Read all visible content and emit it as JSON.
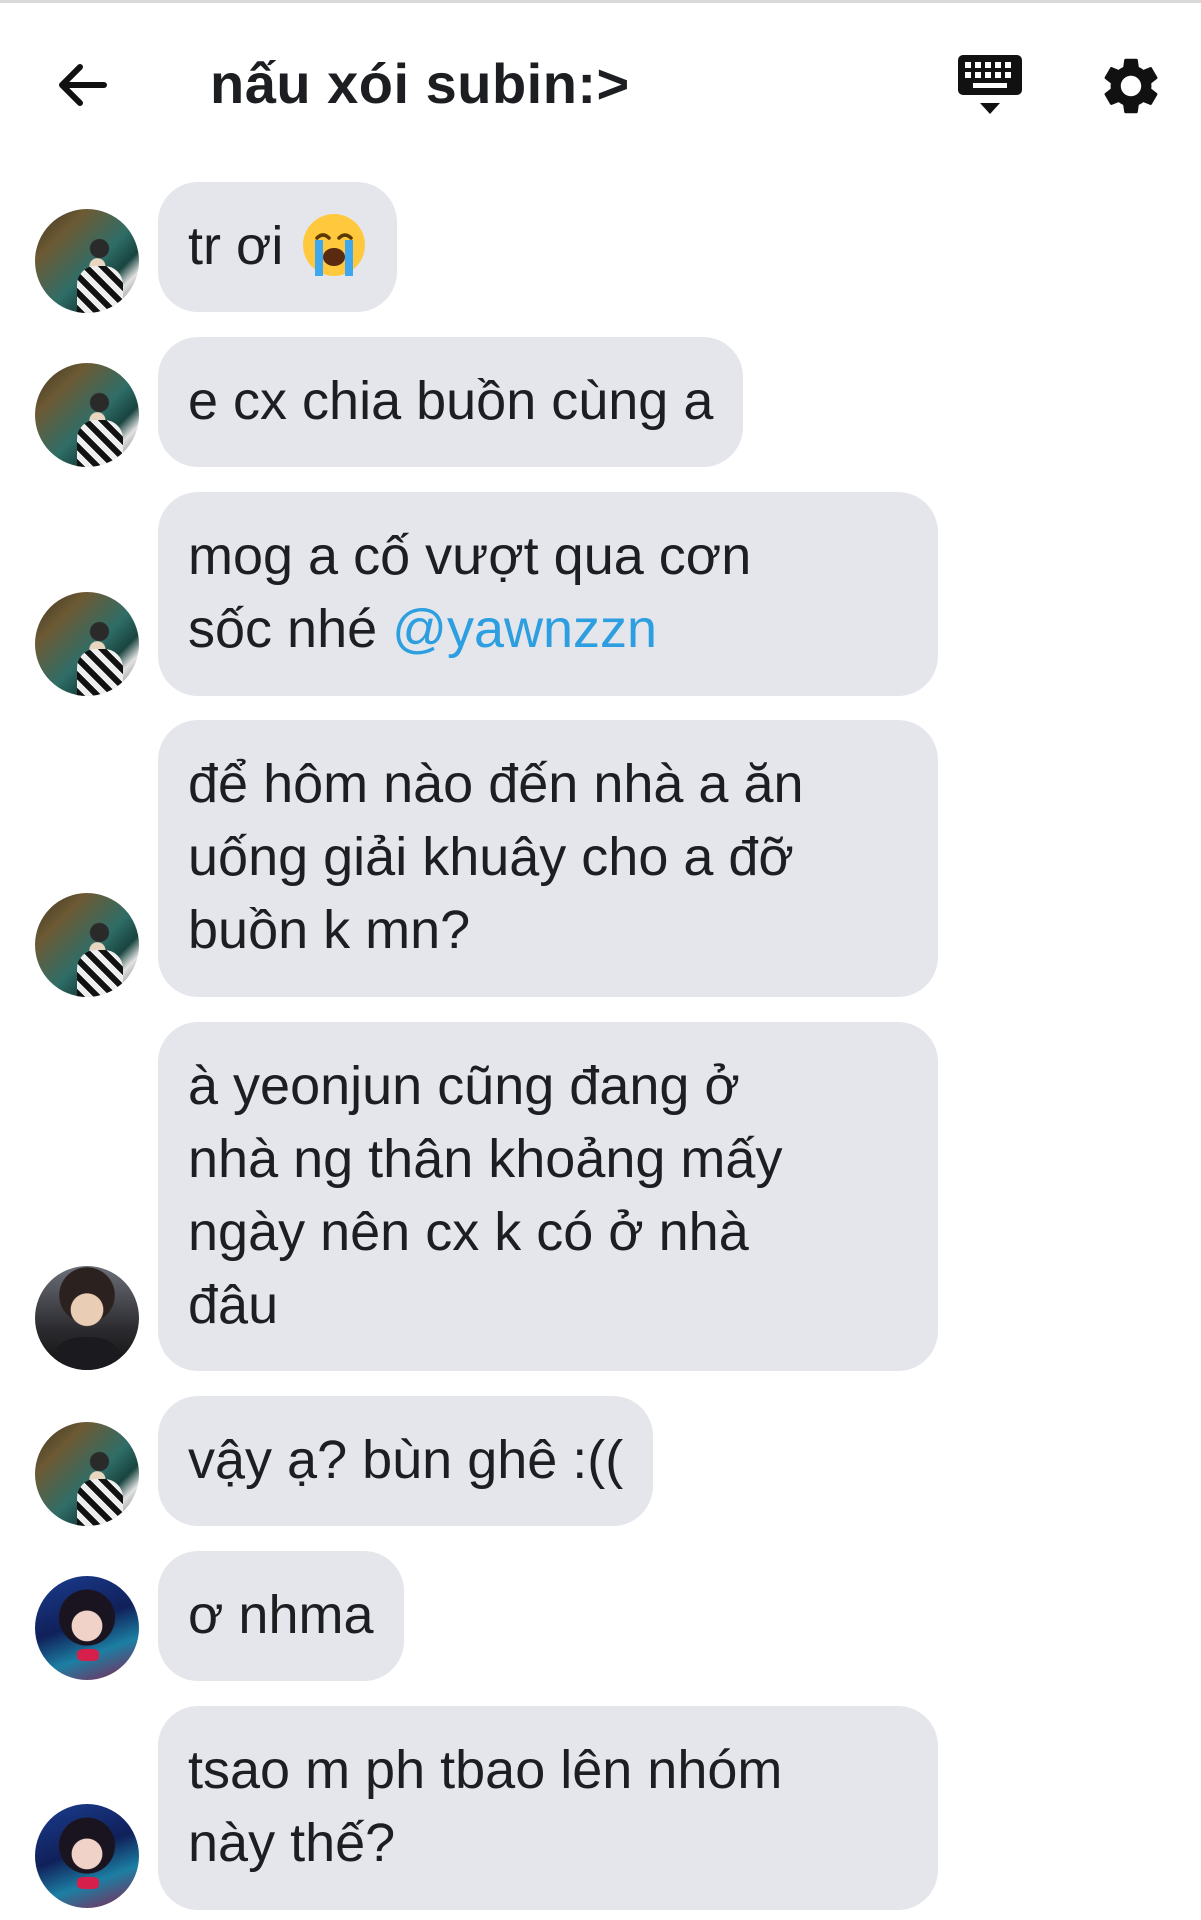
{
  "header": {
    "back_icon": "arrow-left-icon",
    "title": "nấu xói subin:>",
    "keyboard_icon": "keyboard-icon",
    "settings_icon": "gear-icon"
  },
  "messages": [
    {
      "avatar": "avatar-a",
      "text": "tr ơi",
      "emoji": "loudly-crying-face"
    },
    {
      "avatar": "avatar-a",
      "text": "e cx chia buồn cùng a"
    },
    {
      "avatar": "avatar-a",
      "text": "mog a cố vượt qua cơn\nsốc nhé ",
      "mention": "@yawnzzn"
    },
    {
      "avatar": "avatar-a",
      "text": "để hôm nào đến nhà a ăn\nuống giải khuây cho a đỡ\nbuồn k mn?"
    },
    {
      "avatar": "avatar-b",
      "text": "à yeonjun cũng đang ở\nnhà ng thân khoảng mấy\nngày nên cx k có ở nhà\nđâu"
    },
    {
      "avatar": "avatar-a",
      "text": "vậy ạ? bùn ghê :(("
    },
    {
      "avatar": "avatar-c",
      "text": "ơ nhma"
    },
    {
      "avatar": "avatar-c",
      "text": "tsao m ph tbao lên nhóm\nnày thế?"
    }
  ],
  "colors": {
    "bubble_bg": "#e4e6eb",
    "mention": "#2d9ee0",
    "text": "#1c1e21"
  }
}
